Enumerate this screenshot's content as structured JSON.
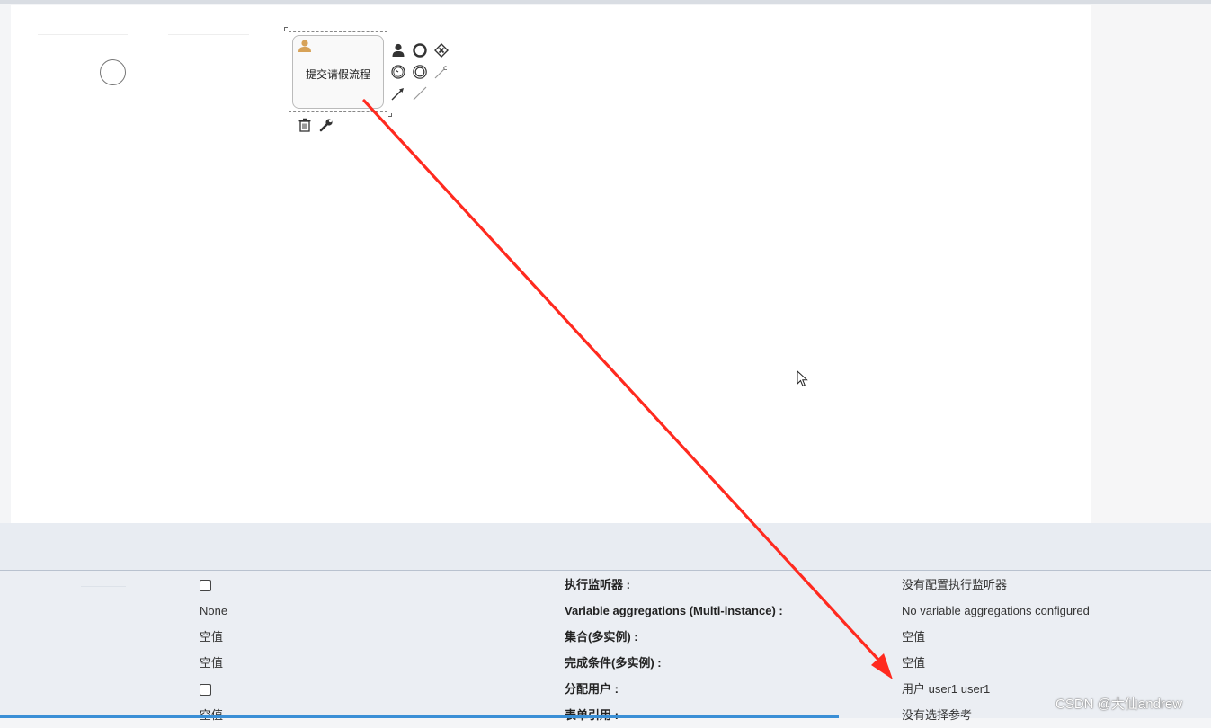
{
  "diagram": {
    "task_label": "提交请假流程"
  },
  "properties": [
    {
      "left": "",
      "left_type": "checkbox",
      "label": "执行监听器 :",
      "value": "没有配置执行监听器"
    },
    {
      "left": "None",
      "left_type": "text",
      "label": "Variable aggregations (Multi-instance) :",
      "value": "No variable aggregations configured"
    },
    {
      "left": "空值",
      "left_type": "text",
      "label": "集合(多实例) :",
      "value": "空值"
    },
    {
      "left": "空值",
      "left_type": "text",
      "label": "完成条件(多实例) :",
      "value": "空值"
    },
    {
      "left": "",
      "left_type": "checkbox",
      "label": "分配用户 :",
      "value": "用户 user1 user1"
    },
    {
      "left": "空值",
      "left_type": "text",
      "label": "表单引用 :",
      "value": "没有选择参考"
    }
  ],
  "watermark": "CSDN @大仙andrew",
  "annotation": {
    "color": "#ff2a1f"
  },
  "colors": {
    "selection_blue": "#3a8fd6",
    "task_user_icon": "#d7a257"
  }
}
